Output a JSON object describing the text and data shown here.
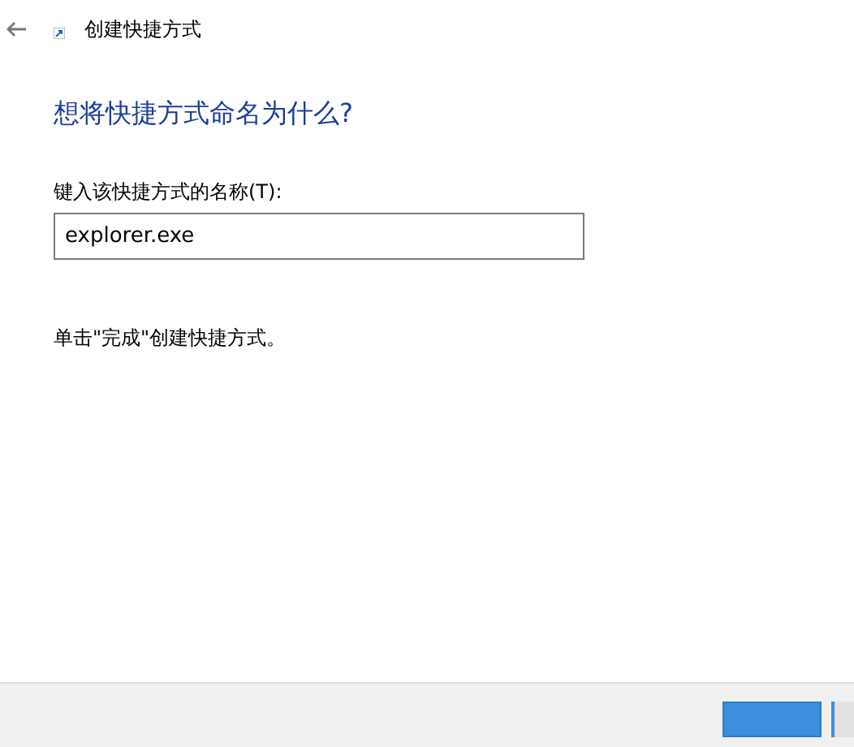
{
  "window": {
    "title": "创建快捷方式"
  },
  "heading": "想将快捷方式命名为什么?",
  "name_field": {
    "label": "键入该快捷方式的名称(T):",
    "value": "explorer.exe"
  },
  "instruction": "单击\"完成\"创建快捷方式。"
}
